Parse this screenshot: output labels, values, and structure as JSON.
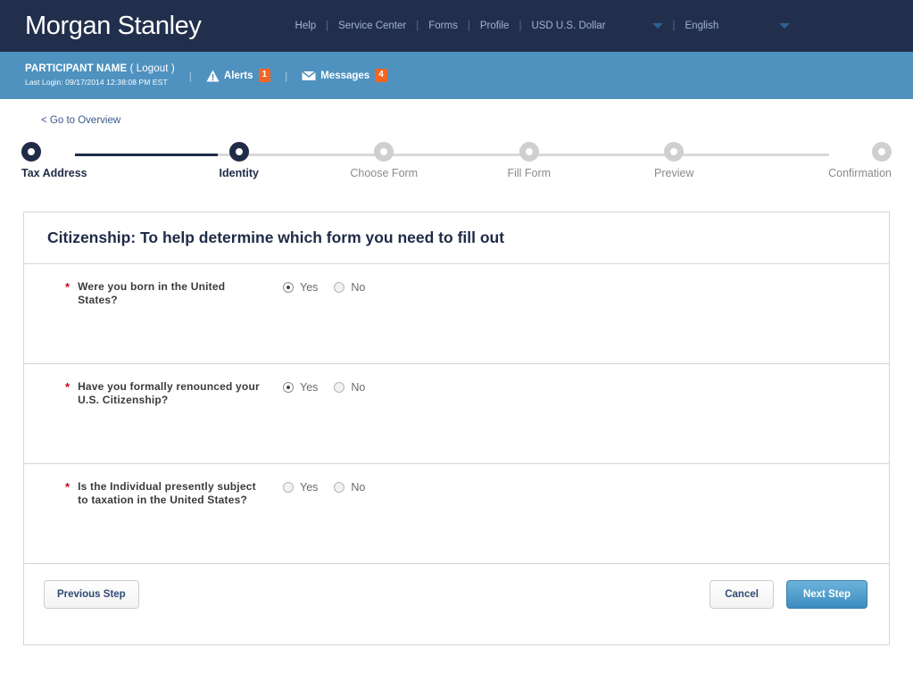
{
  "brand": {
    "name": "Morgan Stanley"
  },
  "topnav": {
    "links": [
      {
        "label": "Help"
      },
      {
        "label": "Service Center"
      },
      {
        "label": "Forms"
      },
      {
        "label": "Profile"
      }
    ],
    "separator": "|",
    "currency": {
      "label": "USD U.S. Dollar",
      "icon": "chevron-down-icon"
    },
    "language": {
      "label": "English",
      "icon": "chevron-down-icon"
    }
  },
  "userbar": {
    "participant_name": "PARTICIPANT NAME",
    "logout": "( Logout )",
    "last_login": "Last Login: 09/17/2014 12:38:08 PM  EST",
    "separator": "|",
    "alerts": {
      "label": "Alerts",
      "count": "1",
      "icon": "warning-triangle-icon"
    },
    "messages": {
      "label": "Messages",
      "count": "4",
      "icon": "envelope-icon"
    }
  },
  "overview_link": "< Go to Overview",
  "stepper": {
    "steps": [
      {
        "label": "Tax Address",
        "state": "done"
      },
      {
        "label": "Identity",
        "state": "current"
      },
      {
        "label": "Choose Form",
        "state": "todo"
      },
      {
        "label": "Fill Form",
        "state": "todo"
      },
      {
        "label": "Preview",
        "state": "todo"
      },
      {
        "label": "Confirmation",
        "state": "todo"
      }
    ]
  },
  "panel": {
    "title": "Citizenship: To help determine which form you need to fill out",
    "required_marker": "*",
    "questions": [
      {
        "text": "Were you born in the United States?",
        "options": [
          {
            "label": "Yes",
            "checked": true
          },
          {
            "label": "No",
            "checked": false
          }
        ]
      },
      {
        "text": "Have you formally renounced your U.S. Citizenship?",
        "options": [
          {
            "label": "Yes",
            "checked": true
          },
          {
            "label": "No",
            "checked": false
          }
        ]
      },
      {
        "text": "Is the Individual presently subject to taxation in the United States?",
        "options": [
          {
            "label": "Yes",
            "checked": false
          },
          {
            "label": "No",
            "checked": false
          }
        ]
      }
    ]
  },
  "footer": {
    "previous_step": "Previous Step",
    "cancel": "Cancel",
    "next_step": "Next Step"
  },
  "colors": {
    "header_navy": "#222f4c",
    "userbar_blue": "#4f92bf",
    "badge_orange": "#f26522",
    "required_red": "#d0021b",
    "primary_button": "#3d8cc0",
    "step_done": "#1f2b47",
    "step_todo": "#cfcfcf"
  }
}
